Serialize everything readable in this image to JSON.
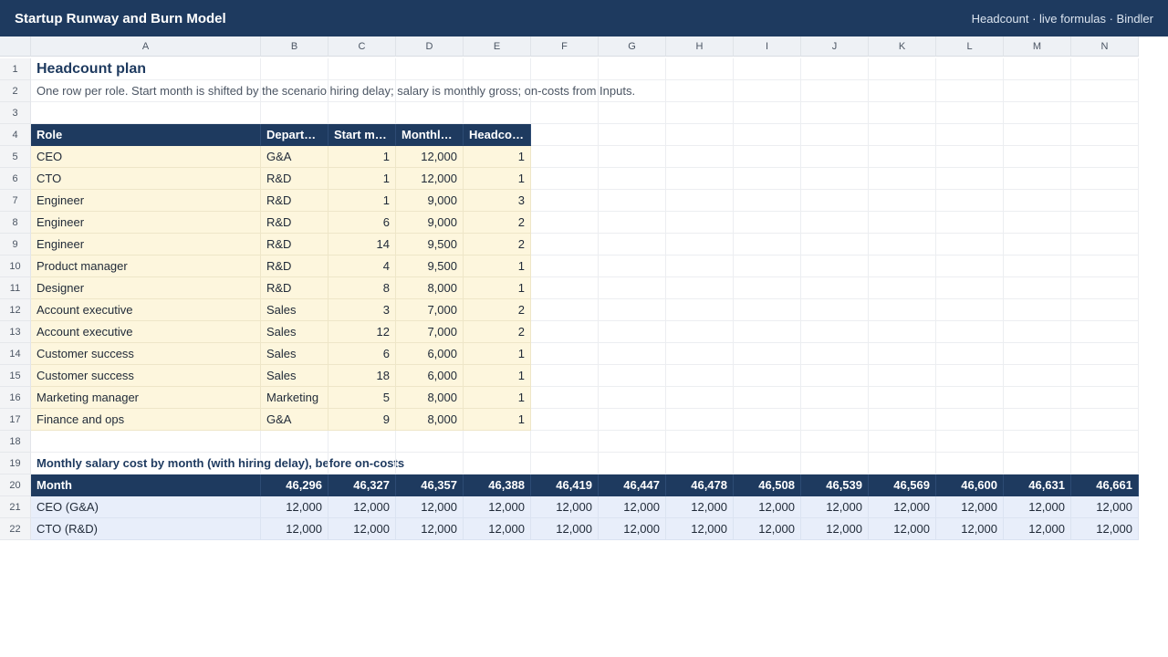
{
  "window": {
    "title": "Startup Runway and Burn Model",
    "subtitle": "Headcount · live formulas · Bindler"
  },
  "sheet": {
    "columns": [
      "A",
      "B",
      "C",
      "D",
      "E",
      "F",
      "G",
      "H",
      "I",
      "J",
      "K",
      "L",
      "M",
      "N"
    ],
    "row_numbers": [
      "1",
      "2",
      "3",
      "4",
      "5",
      "6",
      "7",
      "8",
      "9",
      "10",
      "11",
      "12",
      "13",
      "14",
      "15",
      "16",
      "17",
      "18",
      "19",
      "20",
      "21",
      "22"
    ],
    "title": "Headcount plan",
    "note": "One row per role. Start month is shifted by the scenario hiring delay; salary is monthly gross; on-costs from Inputs.",
    "roles_table": {
      "headers": [
        "Role",
        "Depart…",
        "Start m…",
        "Monthly…",
        "Headcount"
      ],
      "rows": [
        [
          "CEO",
          "G&A",
          "1",
          "12,000",
          "1"
        ],
        [
          "CTO",
          "R&D",
          "1",
          "12,000",
          "1"
        ],
        [
          "Engineer",
          "R&D",
          "1",
          "9,000",
          "3"
        ],
        [
          "Engineer",
          "R&D",
          "6",
          "9,000",
          "2"
        ],
        [
          "Engineer",
          "R&D",
          "14",
          "9,500",
          "2"
        ],
        [
          "Product manager",
          "R&D",
          "4",
          "9,500",
          "1"
        ],
        [
          "Designer",
          "R&D",
          "8",
          "8,000",
          "1"
        ],
        [
          "Account executive",
          "Sales",
          "3",
          "7,000",
          "2"
        ],
        [
          "Account executive",
          "Sales",
          "12",
          "7,000",
          "2"
        ],
        [
          "Customer success",
          "Sales",
          "6",
          "6,000",
          "1"
        ],
        [
          "Customer success",
          "Sales",
          "18",
          "6,000",
          "1"
        ],
        [
          "Marketing manager",
          "Marketing",
          "5",
          "8,000",
          "1"
        ],
        [
          "Finance and ops",
          "G&A",
          "9",
          "8,000",
          "1"
        ]
      ]
    },
    "salary_section_title": "Monthly salary cost by month (with hiring delay), before on-costs",
    "salary_table": {
      "header_label": "Month",
      "months": [
        "46,296",
        "46,327",
        "46,357",
        "46,388",
        "46,419",
        "46,447",
        "46,478",
        "46,508",
        "46,539",
        "46,569",
        "46,600",
        "46,631",
        "46,661"
      ],
      "rows": [
        {
          "label": "CEO (G&A)",
          "values": [
            "12,000",
            "12,000",
            "12,000",
            "12,000",
            "12,000",
            "12,000",
            "12,000",
            "12,000",
            "12,000",
            "12,000",
            "12,000",
            "12,000",
            "12,000"
          ]
        },
        {
          "label": "CTO (R&D)",
          "values": [
            "12,000",
            "12,000",
            "12,000",
            "12,000",
            "12,000",
            "12,000",
            "12,000",
            "12,000",
            "12,000",
            "12,000",
            "12,000",
            "12,000",
            "12,000"
          ]
        }
      ]
    }
  },
  "colors": {
    "header_navy": "#1e3a5f",
    "input_fill": "#fdf6dd",
    "calc_fill": "#e8eefa"
  }
}
